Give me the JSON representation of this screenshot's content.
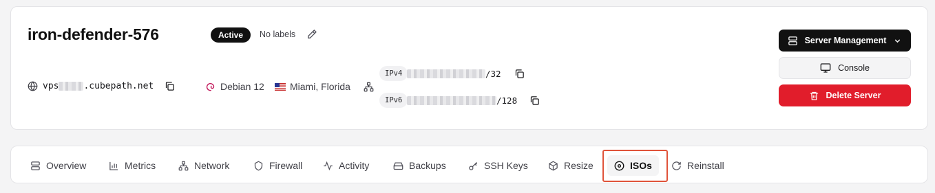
{
  "server": {
    "name": "iron-defender-576",
    "status": "Active",
    "labels_text": "No labels",
    "hostname_prefix": "vps",
    "hostname_suffix": ".cubepath.net",
    "os": "Debian 12",
    "location": "Miami, Florida",
    "ipv4_tag": "IPv4",
    "ipv4_suffix": "/32",
    "ipv6_tag": "IPv6",
    "ipv6_suffix": "/128"
  },
  "actions": {
    "server_management": "Server Management",
    "console": "Console",
    "delete": "Delete Server"
  },
  "tabs": [
    {
      "label": "Overview",
      "icon": "server-icon"
    },
    {
      "label": "Metrics",
      "icon": "bar-chart-icon"
    },
    {
      "label": "Network",
      "icon": "network-icon"
    },
    {
      "label": "Firewall",
      "icon": "shield-icon"
    },
    {
      "label": "Activity",
      "icon": "activity-icon"
    },
    {
      "label": "Backups",
      "icon": "hard-drive-icon"
    },
    {
      "label": "SSH Keys",
      "icon": "key-icon"
    },
    {
      "label": "Resize",
      "icon": "box-icon"
    },
    {
      "label": "ISOs",
      "icon": "disc-icon"
    },
    {
      "label": "Reinstall",
      "icon": "refresh-icon"
    }
  ],
  "active_tab": "ISOs",
  "colors": {
    "danger": "#e11d2b",
    "dark": "#111111",
    "highlight": "#e0533a"
  }
}
